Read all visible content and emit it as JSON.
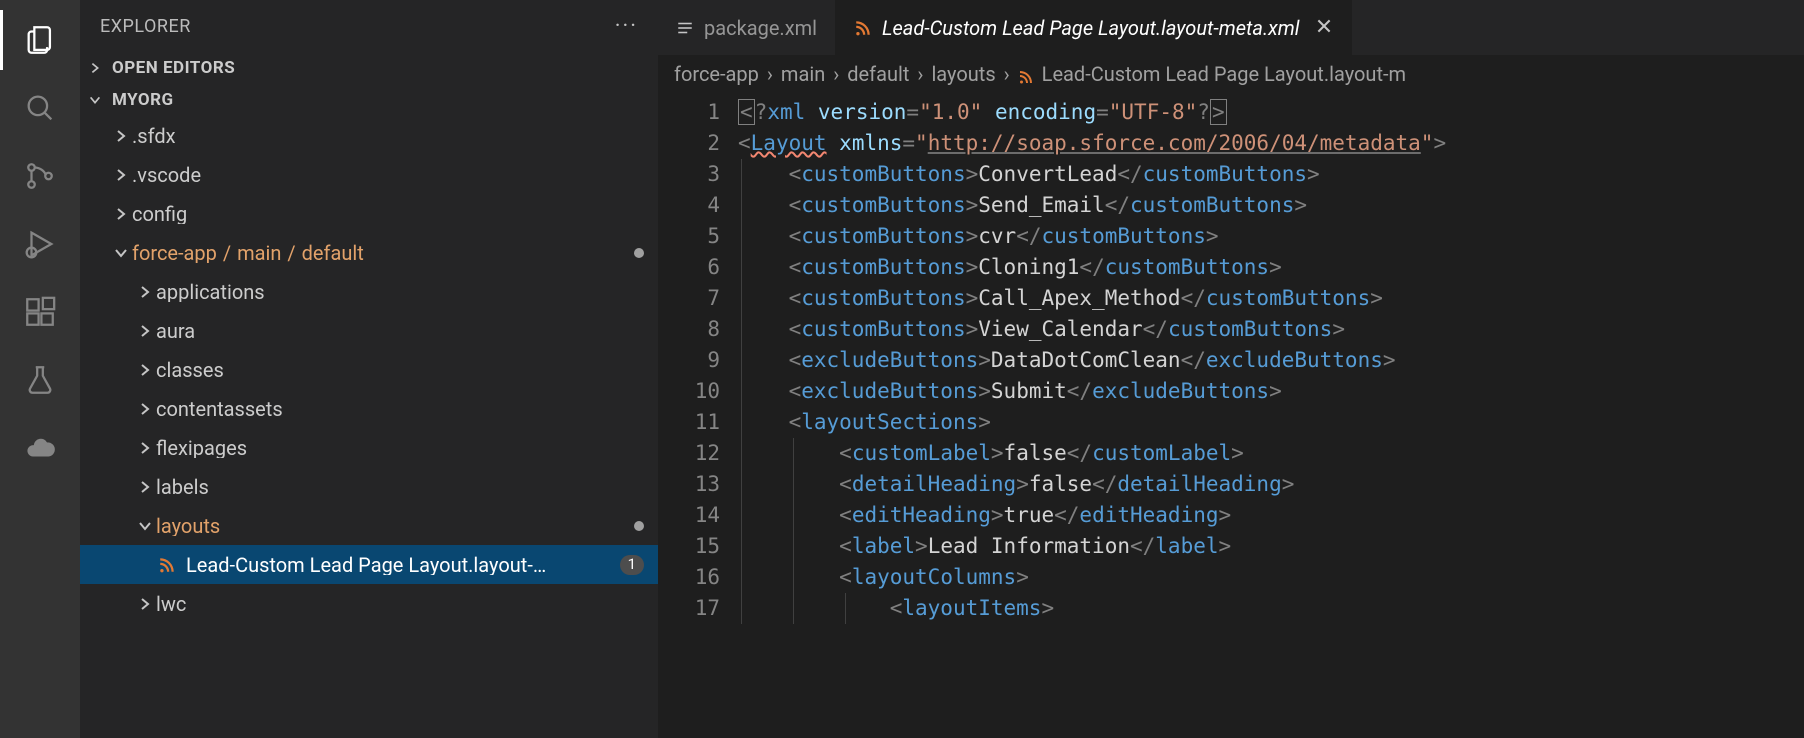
{
  "sidebar": {
    "title": "EXPLORER",
    "sections": {
      "open_editors": "OPEN EDITORS",
      "folder": "MYORG"
    },
    "tree": {
      "sfdx": ".sfdx",
      "vscode": ".vscode",
      "config": "config",
      "forceapp_path": [
        "force-app",
        "main",
        "default"
      ],
      "applications": "applications",
      "aura": "aura",
      "classes": "classes",
      "contentassets": "contentassets",
      "flexipages": "flexipages",
      "labels": "labels",
      "layouts": "layouts",
      "layout_file": "Lead-Custom Lead Page Layout.layout-…",
      "layout_badge": "1",
      "lwc": "lwc"
    }
  },
  "tabs": {
    "package": "package.xml",
    "layout": "Lead-Custom Lead Page Layout.layout-meta.xml"
  },
  "breadcrumb": [
    "force-app",
    "main",
    "default",
    "layouts",
    "Lead-Custom Lead Page Layout.layout-m"
  ],
  "code": {
    "xml_decl_version": "1.0",
    "xml_decl_encoding": "UTF-8",
    "root_tag": "Layout",
    "xmlns": "http://soap.sforce.com/2006/04/metadata",
    "customButtons": [
      "ConvertLead",
      "Send_Email",
      "cvr",
      "Cloning1",
      "Call_Apex_Method",
      "View_Calendar"
    ],
    "excludeButtons": [
      "DataDotComClean",
      "Submit"
    ],
    "layoutSections": {
      "customLabel": "false",
      "detailHeading": "false",
      "editHeading": "true",
      "label": "Lead Information"
    }
  },
  "line_count": 17
}
